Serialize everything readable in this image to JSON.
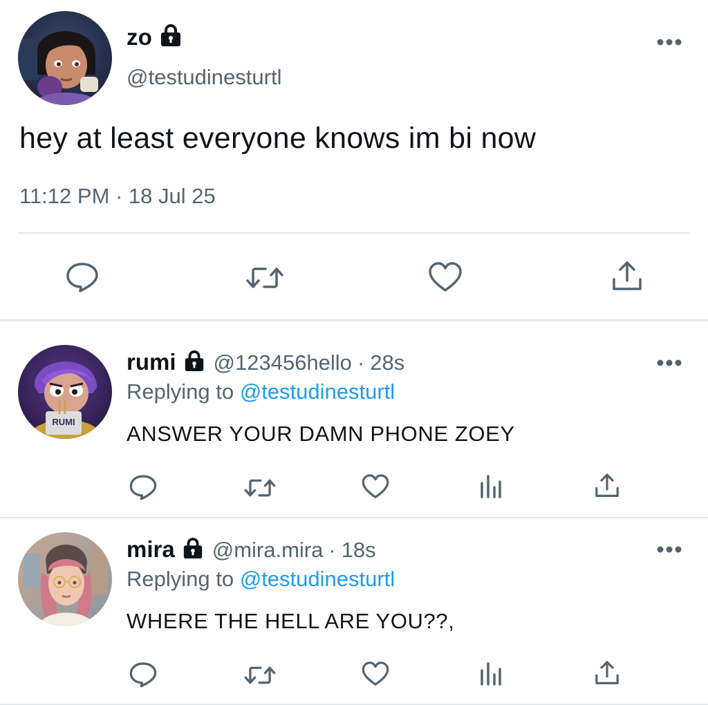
{
  "main_tweet": {
    "author_name": "zo",
    "author_handle": "@testudinesturtl",
    "text": "hey at least everyone knows im bi now",
    "timestamp": "11:12 PM · 18 Jul 25",
    "protected_icon": "lock-icon",
    "more_icon": "more-horizontal-icon",
    "actions": [
      "reply-icon",
      "retweet-icon",
      "like-icon",
      "share-icon"
    ]
  },
  "replies": [
    {
      "author_name": "rumi",
      "author_handle": "@123456hello",
      "separator": "·",
      "time_ago": "28s",
      "replying_prefix": "Replying to ",
      "replying_to": "@testudinesturtl",
      "text": "ANSWER YOUR DAMN PHONE ZOEY",
      "avatar_label": "RUMI"
    },
    {
      "author_name": "mira",
      "author_handle": "@mira.mira",
      "separator": "·",
      "time_ago": "18s",
      "replying_prefix": "Replying to ",
      "replying_to": "@testudinesturtl",
      "text": "WHERE THE HELL ARE YOU??,"
    }
  ],
  "reply_actions": [
    "reply-icon",
    "retweet-icon",
    "like-icon",
    "analytics-icon",
    "share-icon"
  ],
  "colors": {
    "text_primary": "#0f1419",
    "text_secondary": "#536471",
    "link": "#1d9bf0",
    "divider": "#e1e8ed"
  }
}
